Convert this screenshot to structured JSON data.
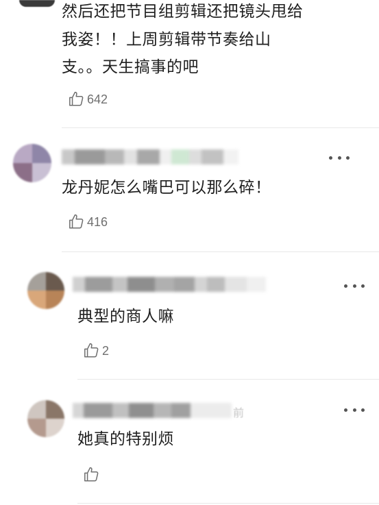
{
  "comment_top": {
    "text_lines": [
      "然后还把节目组剪辑还把镜头甩给",
      "我姿！！上周剪辑带节奏给山",
      "支。。天生搞事的吧"
    ],
    "likes": "642",
    "like_icon": "thumbs-up-icon"
  },
  "comment_main": {
    "username": "",
    "text": "龙丹妮怎么嘴巴可以那么碎！",
    "likes": "416",
    "like_icon": "thumbs-up-icon",
    "more_icon": "more-dots-icon"
  },
  "replies": [
    {
      "username": "",
      "text": "典型的商人嘛",
      "likes": "2",
      "like_icon": "thumbs-up-icon",
      "more_icon": "more-dots-icon"
    },
    {
      "username": "",
      "time_suffix": "前",
      "text": "她真的特别烦",
      "likes": "",
      "like_icon": "thumbs-up-icon",
      "more_icon": "more-dots-icon"
    }
  ],
  "colors": {
    "text": "#1f1f1f",
    "count": "#6f6f6f",
    "divider": "#e8e8e8",
    "icon": "#555555"
  }
}
